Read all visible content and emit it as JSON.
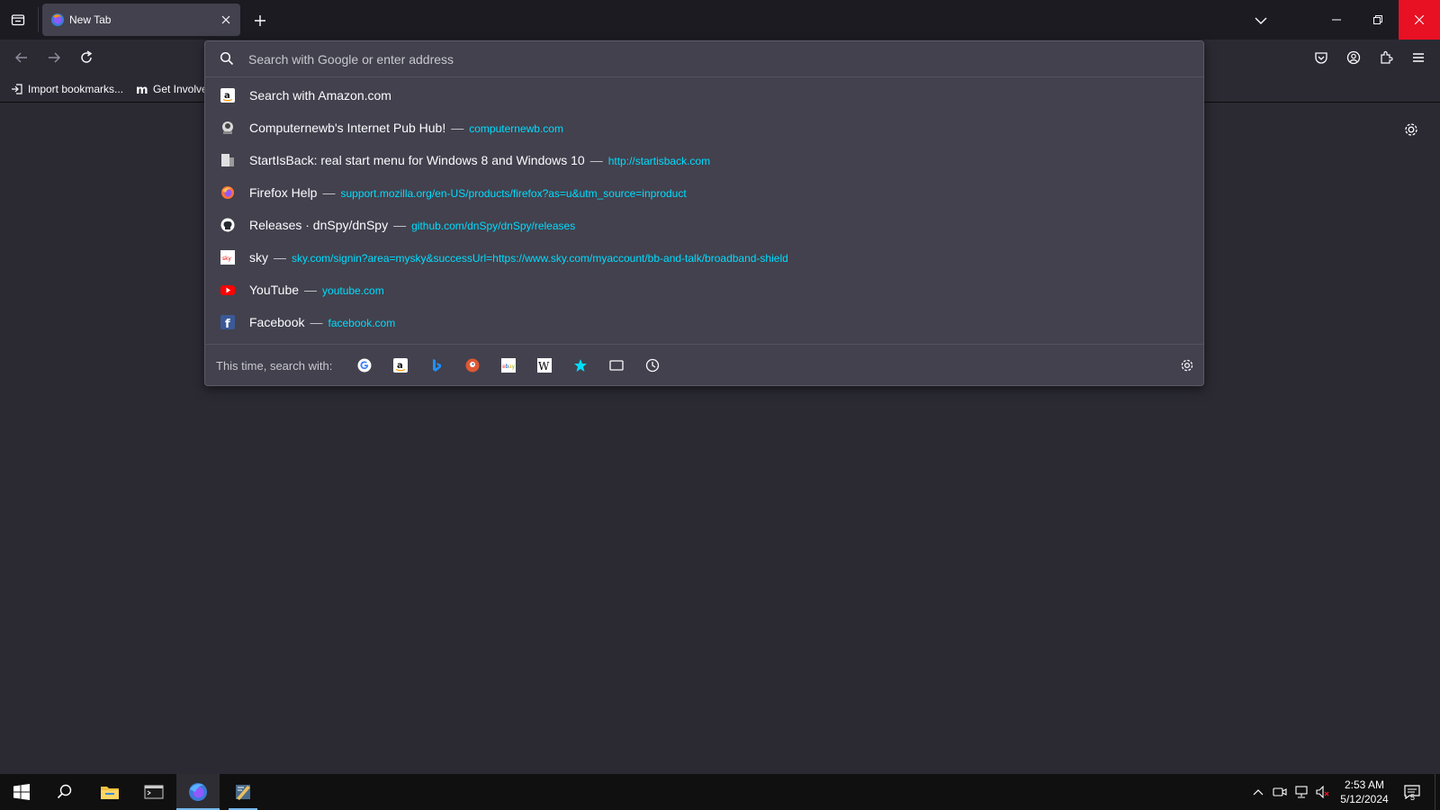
{
  "browser": {
    "tab": {
      "title": "New Tab",
      "favicon": "firefox-icon"
    },
    "nav_icons": [
      "back-icon",
      "forward-icon",
      "reload-icon"
    ],
    "toolbar_icons": [
      "pocket-icon",
      "account-icon",
      "extensions-icon",
      "menu-icon"
    ],
    "bookmarks": [
      {
        "label": "Import bookmarks...",
        "icon": "import-icon"
      },
      {
        "label": "Get Involved",
        "icon": "mozilla-m-icon"
      }
    ]
  },
  "urlbar": {
    "placeholder": "Search with Google or enter address",
    "value": "",
    "results": [
      {
        "title": "Search with Amazon.com",
        "url": "",
        "icon": "amazon-icon"
      },
      {
        "title": "Computernewb's Internet Pub Hub!",
        "url": "computernewb.com",
        "icon": "computernewb-icon"
      },
      {
        "title": "StartIsBack: real start menu for Windows 8 and Windows 10",
        "url": "http://startisback.com",
        "icon": "startisback-icon"
      },
      {
        "title": "Firefox Help",
        "url": "support.mozilla.org/en-US/products/firefox?as=u&utm_source=inproduct",
        "icon": "firefox-icon"
      },
      {
        "title": "Releases · dnSpy/dnSpy",
        "url": "github.com/dnSpy/dnSpy/releases",
        "icon": "github-icon"
      },
      {
        "title": "sky",
        "url": "sky.com/signin?area=mysky&successUrl=https://www.sky.com/myaccount/bb-and-talk/broadband-shield",
        "icon": "sky-icon"
      },
      {
        "title": "YouTube",
        "url": "youtube.com",
        "icon": "youtube-icon"
      },
      {
        "title": "Facebook",
        "url": "facebook.com",
        "icon": "facebook-icon"
      }
    ],
    "dash": "—",
    "one_offs_label": "This time, search with:",
    "one_offs": [
      "google-icon",
      "amazon-icon",
      "bing-icon",
      "duckduckgo-icon",
      "ebay-icon",
      "wikipedia-icon",
      "bookmarks-star-icon",
      "tabs-icon",
      "history-icon"
    ]
  },
  "taskbar": {
    "time": "2:53 AM",
    "date": "5/12/2024",
    "notification_count": "5",
    "apps": [
      "start-icon",
      "search-icon",
      "file-explorer-icon",
      "terminal-icon",
      "firefox-icon",
      "app-icon"
    ]
  },
  "colors": {
    "accent_link": "#00ddff",
    "close_button": "#e81123",
    "toolbar": "#2b2a33",
    "popup": "#42414d"
  }
}
